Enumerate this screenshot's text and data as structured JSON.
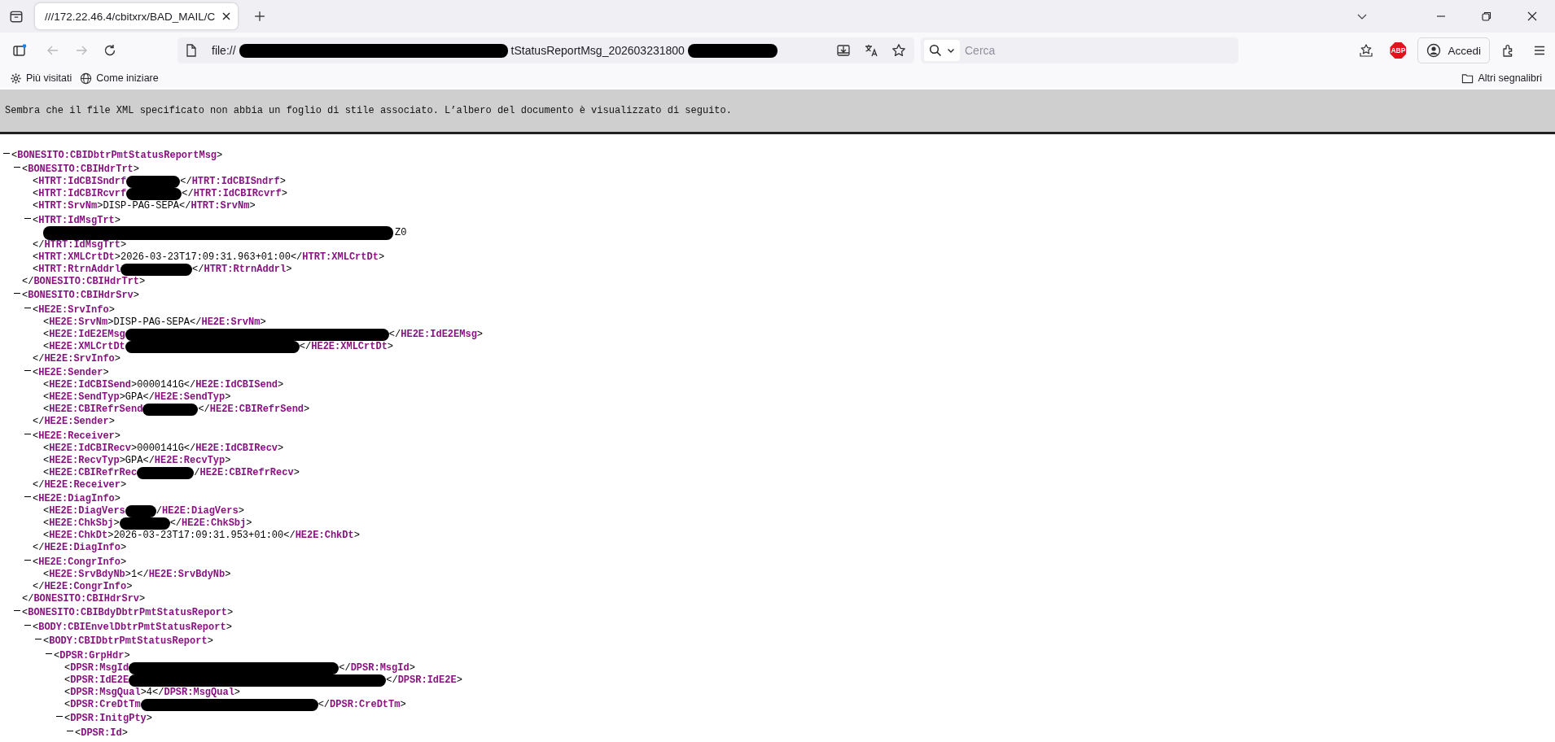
{
  "browser": {
    "tabs": [
      {
        "title": "///172.22.46.4/cbitxrx/BAD_MAIL/C",
        "selected": true
      }
    ],
    "nav": [
      {
        "kind": "back",
        "disabled": true
      },
      {
        "kind": "forward",
        "disabled": true
      },
      {
        "kind": "reload",
        "disabled": false
      }
    ],
    "url": {
      "prefix": "file://",
      "redacted": true,
      "middle": "tStatusReportMsg_202603231800",
      "end_redacted": true
    },
    "search": {
      "placeholder": "Cerca"
    },
    "adblock_badge": "ABP",
    "account_button": "Accedi",
    "bookmarks": [
      {
        "kind": "gear",
        "label": "Più visitati"
      },
      {
        "kind": "globe",
        "label": "Come iniziare"
      }
    ],
    "other_bookmarks": "Altri segnalibri"
  },
  "notice": "Sembra che il file XML specificato non abbia un foglio di stile associato. L’albero del documento è visualizzato di seguito.",
  "xml": [
    {
      "kind": "element",
      "open": "<BONESITO:CBIDbtrPmtStatusReportMsg>",
      "expanded": true,
      "children": [
        {
          "kind": "element",
          "open": "<BONESITO:CBIHdrTrt>",
          "expanded": true,
          "close": "</BONESITO:CBIHdrTrt>",
          "children": [
            {
              "kind": "leaf",
              "open": "<HTRT:IdCBISndrf",
              "redacted": true,
              "close": "</HTRT:IdCBISndrf>"
            },
            {
              "kind": "leaf",
              "open": "<HTRT:IdCBIRcvrf",
              "redacted": true,
              "close": "</HTRT:IdCBIRcvrf>"
            },
            {
              "kind": "leaf",
              "open": "<HTRT:SrvNm>",
              "value": "DISP-PAG-SEPA",
              "close": "</HTRT:SrvNm>"
            },
            {
              "kind": "element",
              "open": "<HTRT:IdMsgTrt>",
              "expanded": true,
              "close": "</HTRT:IdMsgTrt>",
              "children": [
                {
                  "kind": "text",
                  "redacted": true,
                  "value": "Z0"
                }
              ]
            },
            {
              "kind": "leaf",
              "open": "<HTRT:XMLCrtDt>",
              "value": "2026-03-23T17:09:31.963+01:00",
              "close": "</HTRT:XMLCrtDt>"
            },
            {
              "kind": "leaf",
              "open": "<HTRT:RtrnAddrl",
              "redacted": true,
              "close": "</HTRT:RtrnAddrl>"
            }
          ]
        },
        {
          "kind": "element",
          "open": "<BONESITO:CBIHdrSrv>",
          "expanded": true,
          "close": "</BONESITO:CBIHdrSrv>",
          "children": [
            {
              "kind": "element",
              "open": "<HE2E:SrvInfo>",
              "expanded": true,
              "close": "</HE2E:SrvInfo>",
              "children": [
                {
                  "kind": "leaf",
                  "open": "<HE2E:SrvNm>",
                  "value": "DISP-PAG-SEPA",
                  "close": "</HE2E:SrvNm>"
                },
                {
                  "kind": "leaf",
                  "open": "<HE2E:IdE2EMsg",
                  "redacted": true,
                  "close": "</HE2E:IdE2EMsg>"
                },
                {
                  "kind": "leaf",
                  "open": "<HE2E:XMLCrtDt",
                  "redacted": true,
                  "close": "</HE2E:XMLCrtDt>"
                }
              ]
            },
            {
              "kind": "element",
              "open": "<HE2E:Sender>",
              "expanded": true,
              "close": "</HE2E:Sender>",
              "children": [
                {
                  "kind": "leaf",
                  "open": "<HE2E:IdCBISend>",
                  "value": "0000141G",
                  "close": "</HE2E:IdCBISend>"
                },
                {
                  "kind": "leaf",
                  "open": "<HE2E:SendTyp>",
                  "value": "GPA",
                  "close": "</HE2E:SendTyp>"
                },
                {
                  "kind": "leaf",
                  "open": "<HE2E:CBIRefrSend",
                  "redacted": true,
                  "close": "</HE2E:CBIRefrSend>"
                }
              ]
            },
            {
              "kind": "element",
              "open": "<HE2E:Receiver>",
              "expanded": true,
              "close": "</HE2E:Receiver>",
              "children": [
                {
                  "kind": "leaf",
                  "open": "<HE2E:IdCBIRecv>",
                  "value": "0000141G",
                  "close": "</HE2E:IdCBIRecv>"
                },
                {
                  "kind": "leaf",
                  "open": "<HE2E:RecvTyp>",
                  "value": "GPA",
                  "close": "</HE2E:RecvTyp>"
                },
                {
                  "kind": "leaf",
                  "open": "<HE2E:CBIRefrRec",
                  "redacted": true,
                  "close": "/HE2E:CBIRefrRecv>"
                }
              ]
            },
            {
              "kind": "element",
              "open": "<HE2E:DiagInfo>",
              "expanded": true,
              "close": "</HE2E:DiagInfo>",
              "children": [
                {
                  "kind": "leaf",
                  "open": "<HE2E:DiagVers",
                  "redacted": true,
                  "close": "/HE2E:DiagVers>"
                },
                {
                  "kind": "leaf",
                  "open": "<HE2E:ChkSbj>",
                  "redacted": true,
                  "close": "</HE2E:ChkSbj>"
                },
                {
                  "kind": "leaf",
                  "open": "<HE2E:ChkDt>",
                  "value": "2026-03-23T17:09:31.953+01:00",
                  "close": "</HE2E:ChkDt>"
                }
              ]
            },
            {
              "kind": "element",
              "open": "<HE2E:CongrInfo>",
              "expanded": true,
              "close": "</HE2E:CongrInfo>",
              "children": [
                {
                  "kind": "leaf",
                  "open": "<HE2E:SrvBdyNb>",
                  "value": "1",
                  "close": "</HE2E:SrvBdyNb>"
                }
              ]
            }
          ]
        },
        {
          "kind": "element",
          "open": "<BONESITO:CBIBdyDbtrPmtStatusReport>",
          "expanded": true,
          "children": [
            {
              "kind": "element",
              "open": "<BODY:CBIEnvelDbtrPmtStatusReport>",
              "expanded": true,
              "children": [
                {
                  "kind": "element",
                  "open": "<BODY:CBIDbtrPmtStatusReport>",
                  "expanded": true,
                  "children": [
                    {
                      "kind": "element",
                      "open": "<DPSR:GrpHdr>",
                      "expanded": true,
                      "children": [
                        {
                          "kind": "leaf",
                          "open": "<DPSR:MsgId",
                          "redacted": true,
                          "close": "</DPSR:MsgId>"
                        },
                        {
                          "kind": "leaf",
                          "open": "<DPSR:IdE2E",
                          "redacted": true,
                          "close": "</DPSR:IdE2E>"
                        },
                        {
                          "kind": "leaf",
                          "open": "<DPSR:MsgQual>",
                          "value": "4",
                          "close": "</DPSR:MsgQual>"
                        },
                        {
                          "kind": "leaf",
                          "open": "<DPSR:CreDtTm",
                          "redacted": true,
                          "close": "</DPSR:CreDtTm>"
                        },
                        {
                          "kind": "element",
                          "open": "<DPSR:InitgPty>",
                          "expanded": true,
                          "children": [
                            {
                              "kind": "element",
                              "open": "<DPSR:Id>",
                              "expanded": true
                            }
                          ]
                        }
                      ]
                    }
                  ]
                }
              ]
            }
          ]
        }
      ]
    }
  ]
}
